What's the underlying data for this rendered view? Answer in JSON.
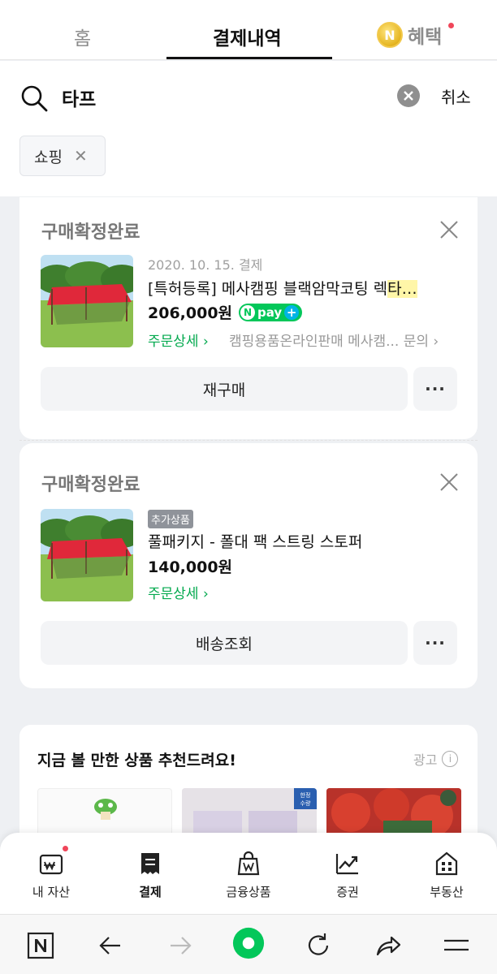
{
  "tabs": {
    "home": "홈",
    "payment": "결제내역",
    "benefit": "혜택",
    "coin_letter": "N"
  },
  "search": {
    "query": "타프",
    "cancel": "취소",
    "filter_chip": "쇼핑"
  },
  "orders": [
    {
      "status": "구매확정완료",
      "date": "2020. 10. 15. 결제",
      "name_prefix": "[특허등록] 메사캠핑 블랙암막코팅 렉",
      "name_highlight": "타",
      "name_suffix": "…",
      "price": "206,000원",
      "npay": "pay",
      "detail": "주문상세 ›",
      "seller": "캠핑용품온라인판매 메사캠... 문의 ›",
      "button": "재구매",
      "more": "···"
    },
    {
      "status": "구매확정완료",
      "badge": "추가상품",
      "name": "풀패키지 - 폴대 팩 스트링 스토퍼",
      "price": "140,000원",
      "detail": "주문상세 ›",
      "button": "배송조회",
      "more": "···"
    }
  ],
  "recommend": {
    "title": "지금 볼 만한 상품 추천드려요!",
    "ad": "광고",
    "info": "i"
  },
  "bottom_nav": [
    {
      "label": "내 자산",
      "icon": "wallet-won-icon"
    },
    {
      "label": "결제",
      "icon": "receipt-icon"
    },
    {
      "label": "금융상품",
      "icon": "bag-won-icon"
    },
    {
      "label": "증권",
      "icon": "stock-chart-icon"
    },
    {
      "label": "부동산",
      "icon": "building-icon"
    }
  ],
  "colors": {
    "accent_green": "#03c75a",
    "highlight": "#fff6a8",
    "alert_red": "#f0465a"
  }
}
